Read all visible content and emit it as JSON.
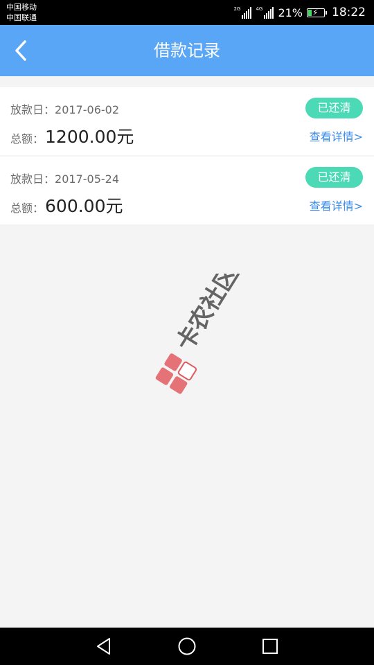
{
  "statusbar": {
    "carrier1": "中国移动",
    "carrier2": "中国联通",
    "signal1_tag": "2G",
    "signal2_tag": "4G",
    "battery_percent": "21%",
    "battery_level": 0.21,
    "time": "18:22"
  },
  "header": {
    "title": "借款记录",
    "back_icon": "chevron-left-icon"
  },
  "loans": [
    {
      "date_label": "放款日：",
      "date": "2017-06-02",
      "amount_label": "总额：",
      "amount": "1200.00元",
      "status": "已还清",
      "detail_link": "查看详情>"
    },
    {
      "date_label": "放款日：",
      "date": "2017-05-24",
      "amount_label": "总额：",
      "amount": "600.00元",
      "status": "已还清",
      "detail_link": "查看详情>"
    }
  ],
  "watermark": {
    "text": "卡农社区",
    "color": "#e05a60"
  },
  "colors": {
    "header": "#5aa6f6",
    "badge": "#4cd9b5",
    "link": "#3d8de8"
  },
  "navbar": {
    "back_icon": "triangle-back-icon",
    "home_icon": "circle-home-icon",
    "recents_icon": "square-recents-icon"
  }
}
